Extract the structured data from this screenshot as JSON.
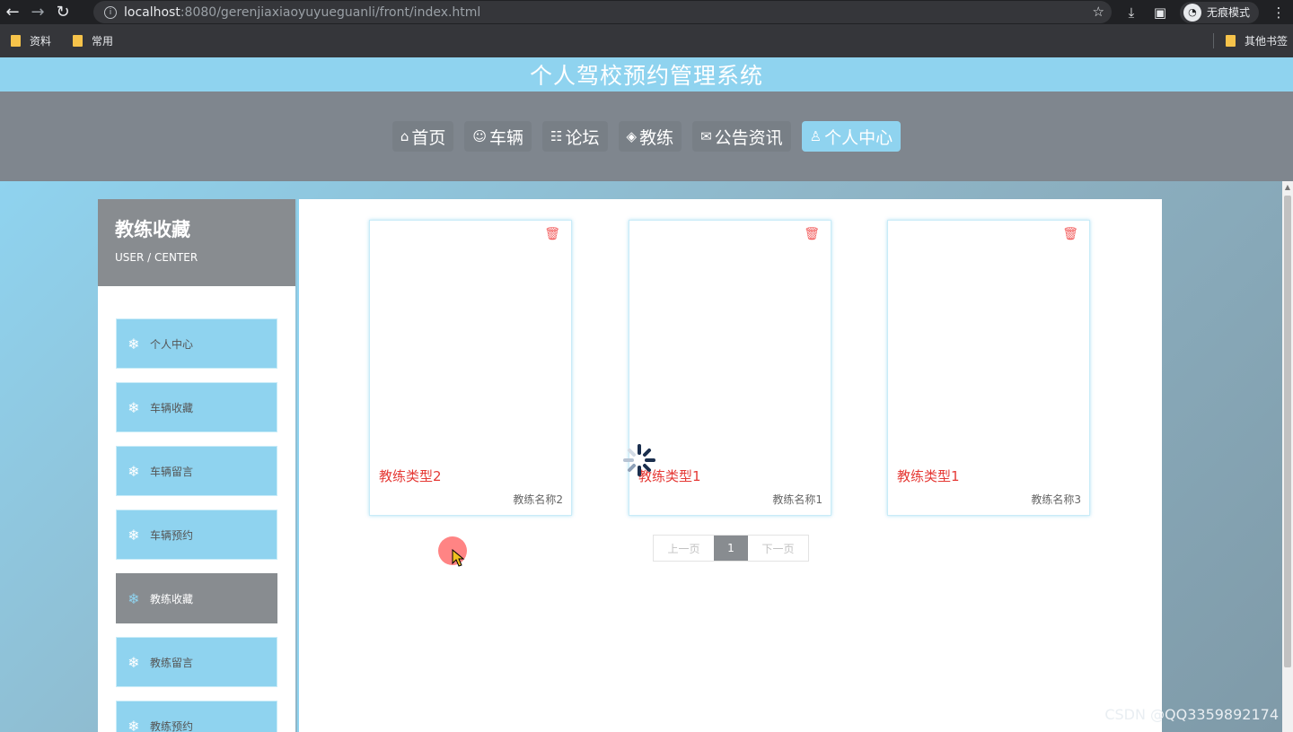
{
  "browser": {
    "url_host": "localhost",
    "url_path": ":8080/gerenjiaxiaoyuyueguanli/front/index.html",
    "incognito_label": "无痕模式",
    "bookmarks": [
      "资料",
      "常用"
    ],
    "bookmarks_other": "其他书签"
  },
  "site": {
    "title": "个人驾校预约管理系统"
  },
  "nav": [
    {
      "icon": "home-icon",
      "glyph": "⌂",
      "label": "首页",
      "active": false
    },
    {
      "icon": "car-icon",
      "glyph": "☺",
      "label": "车辆",
      "active": false
    },
    {
      "icon": "forum-icon",
      "glyph": "☷",
      "label": "论坛",
      "active": false
    },
    {
      "icon": "layers-icon",
      "glyph": "◈",
      "label": "教练",
      "active": false
    },
    {
      "icon": "mail-icon",
      "glyph": "✉",
      "label": "公告资讯",
      "active": false
    },
    {
      "icon": "user-icon",
      "glyph": "♙",
      "label": "个人中心",
      "active": true
    }
  ],
  "sidebar": {
    "title": "教练收藏",
    "subtitle": "USER / CENTER",
    "items": [
      {
        "label": "个人中心",
        "active": false
      },
      {
        "label": "车辆收藏",
        "active": false
      },
      {
        "label": "车辆留言",
        "active": false
      },
      {
        "label": "车辆预约",
        "active": false
      },
      {
        "label": "教练收藏",
        "active": true
      },
      {
        "label": "教练留言",
        "active": false
      },
      {
        "label": "教练预约",
        "active": false
      }
    ]
  },
  "cards": [
    {
      "type": "教练类型2",
      "name": "教练名称2"
    },
    {
      "type": "教练类型1",
      "name": "教练名称1"
    },
    {
      "type": "教练类型1",
      "name": "教练名称3"
    }
  ],
  "pager": {
    "prev": "上一页",
    "current": "1",
    "next": "下一页"
  },
  "watermark": "CSDN @QQ3359892174",
  "colors": {
    "accent": "#8fd3ef",
    "nav_bg": "#7f868e",
    "sidebar_head": "#888c90",
    "card_type": "#e53935"
  }
}
